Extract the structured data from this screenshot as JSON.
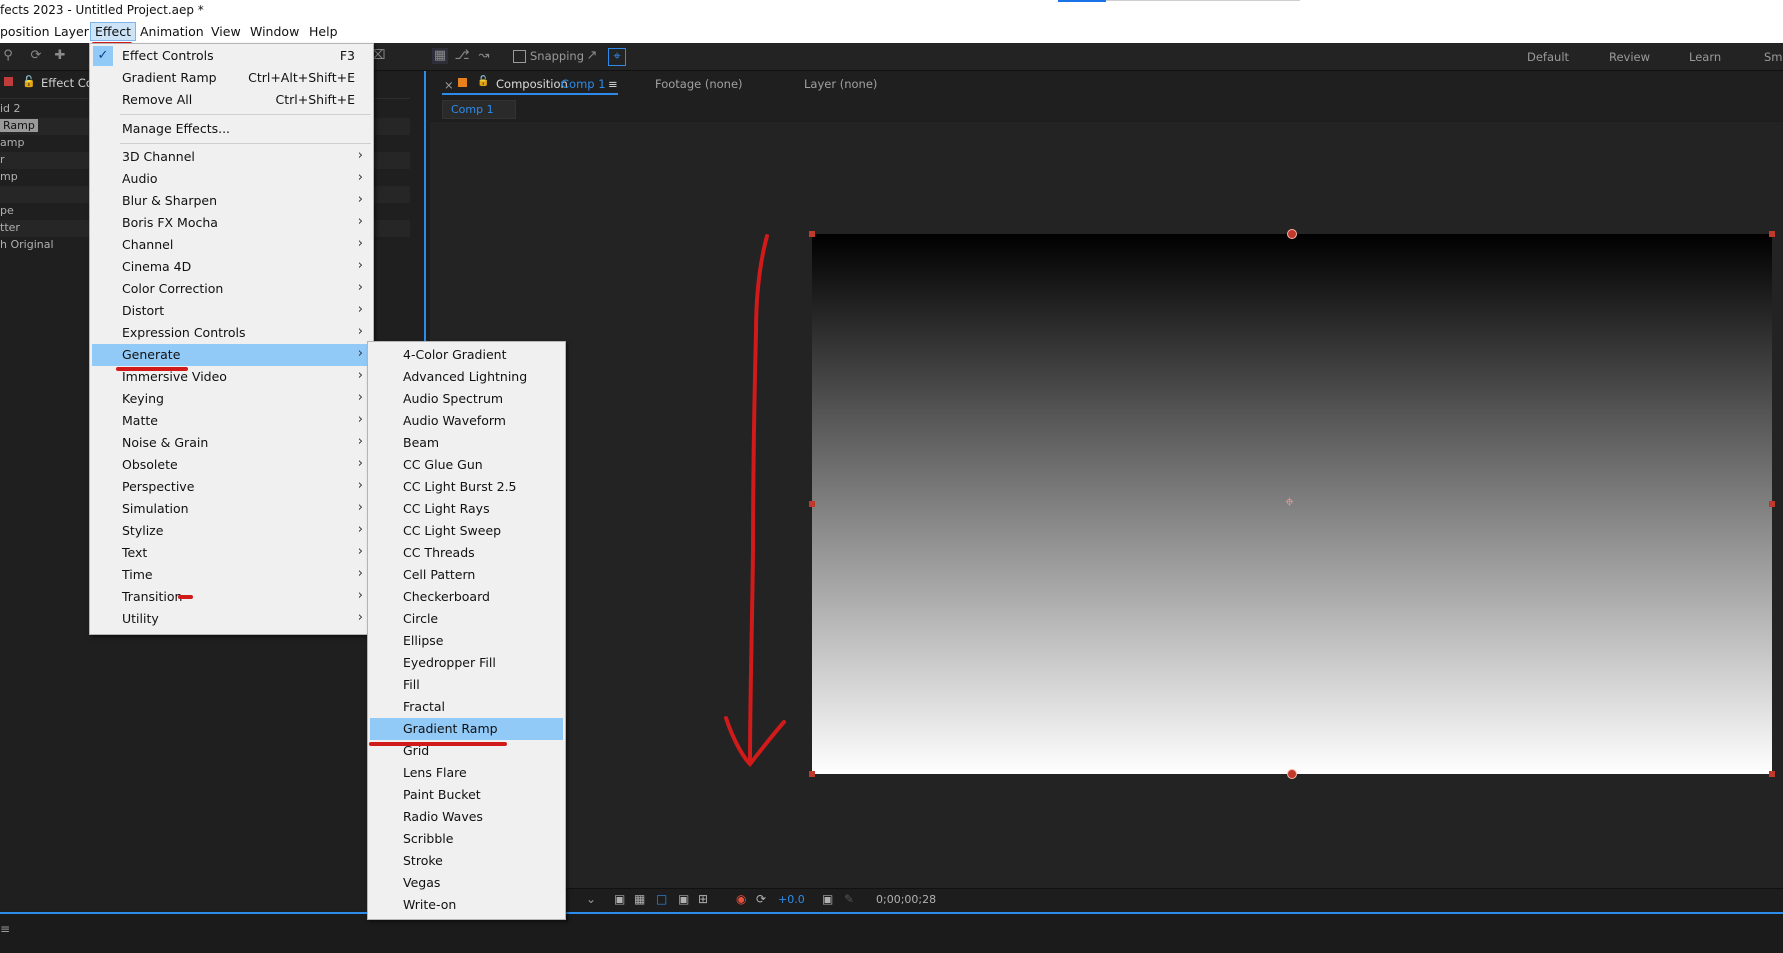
{
  "window": {
    "title": "fects 2023 - Untitled Project.aep *"
  },
  "menubar": {
    "items": [
      "position",
      "Layer",
      "Effect",
      "Animation",
      "View",
      "Window",
      "Help"
    ]
  },
  "toolbar": {
    "snapping_label": "Snapping",
    "workspaces": [
      "Default",
      "Review",
      "Learn",
      "Sm"
    ]
  },
  "effect_controls": {
    "tab_label": "Effect Con",
    "layer_label": "id 2",
    "rows": [
      "Ramp",
      "amp",
      "r",
      "mp",
      "",
      "pe",
      "tter",
      "h Original"
    ]
  },
  "composition": {
    "tab_prefix": "Composition",
    "comp_name": "Comp 1",
    "footage_tab": "Footage (none)",
    "layer_tab": "Layer (none)",
    "breadcrumb": "Comp 1"
  },
  "viewer_footer": {
    "exposure": "+0.0",
    "timecode": "0;00;00;28"
  },
  "effect_menu": {
    "top_items": [
      {
        "label": "Effect Controls",
        "shortcut": "F3",
        "checked": true
      },
      {
        "label": "Gradient Ramp",
        "shortcut": "Ctrl+Alt+Shift+E"
      },
      {
        "label": "Remove All",
        "shortcut": "Ctrl+Shift+E"
      }
    ],
    "manage": "Manage Effects...",
    "categories": [
      "3D Channel",
      "Audio",
      "Blur & Sharpen",
      "Boris FX Mocha",
      "Channel",
      "Cinema 4D",
      "Color Correction",
      "Distort",
      "Expression Controls",
      "Generate",
      "Immersive Video",
      "Keying",
      "Matte",
      "Noise & Grain",
      "Obsolete",
      "Perspective",
      "Simulation",
      "Stylize",
      "Text",
      "Time",
      "Transition",
      "Utility"
    ],
    "highlighted": "Generate"
  },
  "generate_submenu": {
    "items": [
      "4-Color Gradient",
      "Advanced Lightning",
      "Audio Spectrum",
      "Audio Waveform",
      "Beam",
      "CC Glue Gun",
      "CC Light Burst 2.5",
      "CC Light Rays",
      "CC Light Sweep",
      "CC Threads",
      "Cell Pattern",
      "Checkerboard",
      "Circle",
      "Ellipse",
      "Eyedropper Fill",
      "Fill",
      "Fractal",
      "Gradient Ramp",
      "Grid",
      "Lens Flare",
      "Paint Bucket",
      "Radio Waves",
      "Scribble",
      "Stroke",
      "Vegas",
      "Write-on"
    ],
    "highlighted": "Gradient Ramp"
  },
  "colors": {
    "highlight": "#91c9f7",
    "annotation": "#d11a1a",
    "accent": "#2d8ceb"
  }
}
